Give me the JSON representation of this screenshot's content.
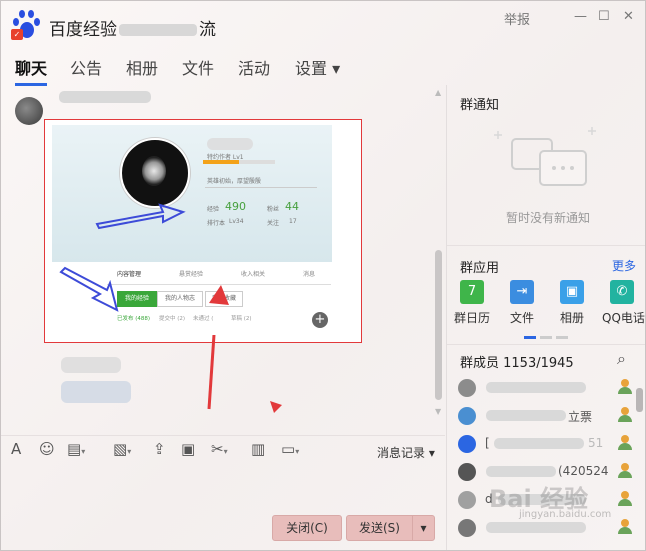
{
  "window": {
    "title_visible": "百度经验",
    "title_suffix": "流",
    "report_label": "举报",
    "minimize_glyph": "—",
    "maximize_glyph": "☐",
    "close_glyph": "✕"
  },
  "tabs": [
    {
      "label": "聊天",
      "active": true
    },
    {
      "label": "公告"
    },
    {
      "label": "相册"
    },
    {
      "label": "文件"
    },
    {
      "label": "活动"
    },
    {
      "label": "设置 ▾"
    }
  ],
  "screenshot_content": {
    "level": "特约作者 Lv1",
    "tagline": "英雄初始，厚望殷殷",
    "exp_label": "经验",
    "exp_value": "490",
    "fans_label": "粉丝",
    "fans_value": "44",
    "rank_label": "排行本",
    "rank_value": "Lv34",
    "follow_label": "关注",
    "follow_value": "17",
    "tabs": [
      "内容管理",
      "悬赏经验",
      "收入相关",
      "消息"
    ],
    "buttons": [
      "我的经验",
      "我的人物志",
      "我的收藏"
    ],
    "sub": [
      "已发布 (488)",
      "提交中 (2)",
      "未通过 (",
      "草稿 (2)"
    ]
  },
  "toolbar": {
    "history_label": "消息记录 ▾"
  },
  "buttons": {
    "close_label": "关闭(C)",
    "send_label": "发送(S)",
    "send_menu": "▾"
  },
  "notice": {
    "title": "群通知",
    "empty_text": "暂时没有新通知"
  },
  "apps": {
    "title": "群应用",
    "more_label": "更多",
    "items": [
      {
        "label": "群日历",
        "icon": "calendar-icon",
        "glyph": "7",
        "color": "#3fb54a"
      },
      {
        "label": "文件",
        "icon": "upload-file-icon",
        "glyph": "⇥",
        "color": "#3b8de0"
      },
      {
        "label": "相册",
        "icon": "photo-icon",
        "glyph": "▣",
        "color": "#3aa0e8"
      },
      {
        "label": "QQ电话",
        "icon": "phone-icon",
        "glyph": "✆",
        "color": "#22b3a0"
      }
    ]
  },
  "members": {
    "title": "群成员 1153/1945",
    "list": [
      {
        "name": ""
      },
      {
        "name": "立票"
      },
      {
        "name": "[",
        "suffix": "51"
      },
      {
        "name": "",
        "suffix": "(420524"
      },
      {
        "name": "d"
      },
      {
        "name": ""
      }
    ]
  },
  "watermark": {
    "text": "Bai 经验",
    "url": "jingyan.baidu.com"
  },
  "colors": {
    "accent": "#2b66e2",
    "annotation_red": "#e2393b",
    "button_pink": "#e8bdbb"
  }
}
